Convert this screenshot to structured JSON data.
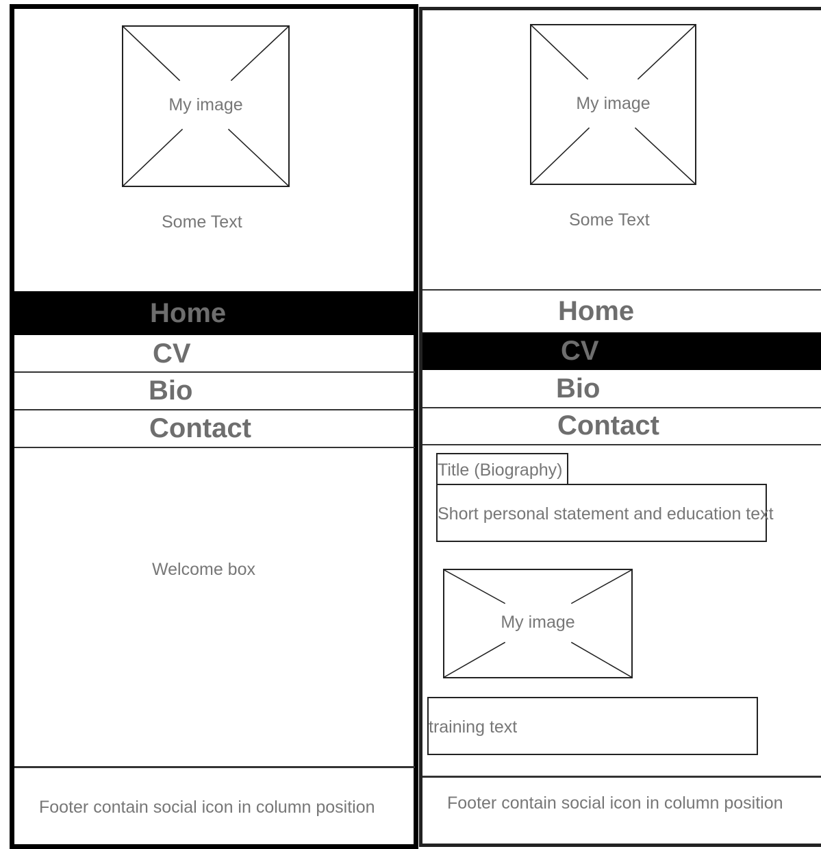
{
  "left_mockup": {
    "header": {
      "image_label": "My image",
      "text": "Some Text"
    },
    "nav": [
      {
        "label": "Home",
        "active": true
      },
      {
        "label": "CV",
        "active": false
      },
      {
        "label": "Bio",
        "active": false
      },
      {
        "label": "Contact",
        "active": false
      }
    ],
    "main": {
      "text": "Welcome box"
    },
    "footer": {
      "text": "Footer contain social icon in column position"
    }
  },
  "right_mockup": {
    "header": {
      "image_label": "My image",
      "text": "Some Text"
    },
    "nav": [
      {
        "label": "Home",
        "active": false
      },
      {
        "label": "CV",
        "active": true
      },
      {
        "label": "Bio",
        "active": false
      },
      {
        "label": "Contact",
        "active": false
      }
    ],
    "main": {
      "title": "Title (Biography)",
      "statement": "Short personal statement and education text",
      "image_label": "My image",
      "training": "training text"
    },
    "footer": {
      "text": "Footer contain social icon in column position"
    }
  }
}
